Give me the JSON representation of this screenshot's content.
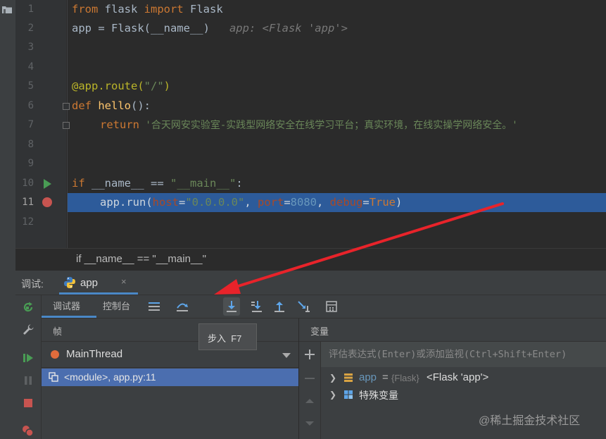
{
  "editor": {
    "line_numbers": [
      "1",
      "2",
      "3",
      "4",
      "5",
      "6",
      "7",
      "8",
      "9",
      "10",
      "11",
      "12"
    ],
    "lines": {
      "l1": {
        "kw1": "from",
        "mod": " flask ",
        "kw2": "import",
        "cls": " Flask"
      },
      "l2": {
        "code": "app = Flask(__name__)",
        "hint": "app: <Flask 'app'>"
      },
      "l5": {
        "dec": "@app.route(",
        "str": "\"/\"",
        "close": ")"
      },
      "l6": {
        "kw": "def",
        "fn": " hello",
        "rest": "():"
      },
      "l7": {
        "kw": "return",
        "str": " '合天网安实验室-实践型网络安全在线学习平台；真实环境，在线实操学网络安全。'"
      },
      "l10": {
        "kw": "if",
        "rest": " __name__ == ",
        "str": "\"__main__\"",
        "colon": ":"
      },
      "l11": {
        "pre": "app.run(",
        "p1": "host",
        "eq1": "=",
        "v1": "\"0.0.0.0\"",
        "c1": ", ",
        "p2": "port",
        "eq2": "=",
        "v2": "8080",
        "c2": ", ",
        "p3": "debug",
        "eq3": "=",
        "v3": "True",
        "close": ")"
      }
    }
  },
  "breadcrumb": "if __name__ == \"__main__\"",
  "debug": {
    "label": "调试:",
    "tab_label": "app",
    "tab_close": "×",
    "subtabs": {
      "debugger": "调试器",
      "console": "控制台"
    },
    "frames_header": "帧",
    "thread": "MainThread",
    "frame": "<module>, app.py:11",
    "variables_header": "变量",
    "eval_placeholder": "评估表达式(Enter)或添加监视(Ctrl+Shift+Enter)",
    "vars": {
      "app": {
        "name": "app",
        "eq": "=",
        "type": "{Flask}",
        "value": "<Flask 'app'>"
      },
      "special": {
        "label": "特殊变量"
      }
    },
    "tooltip": "步入  F7"
  },
  "watermark": "@稀土掘金技术社区",
  "colors": {
    "accent": "#4a88c7",
    "selection": "#2d5b9a",
    "breakpoint": "#c75450",
    "annotation_arrow": "#e8232a"
  }
}
